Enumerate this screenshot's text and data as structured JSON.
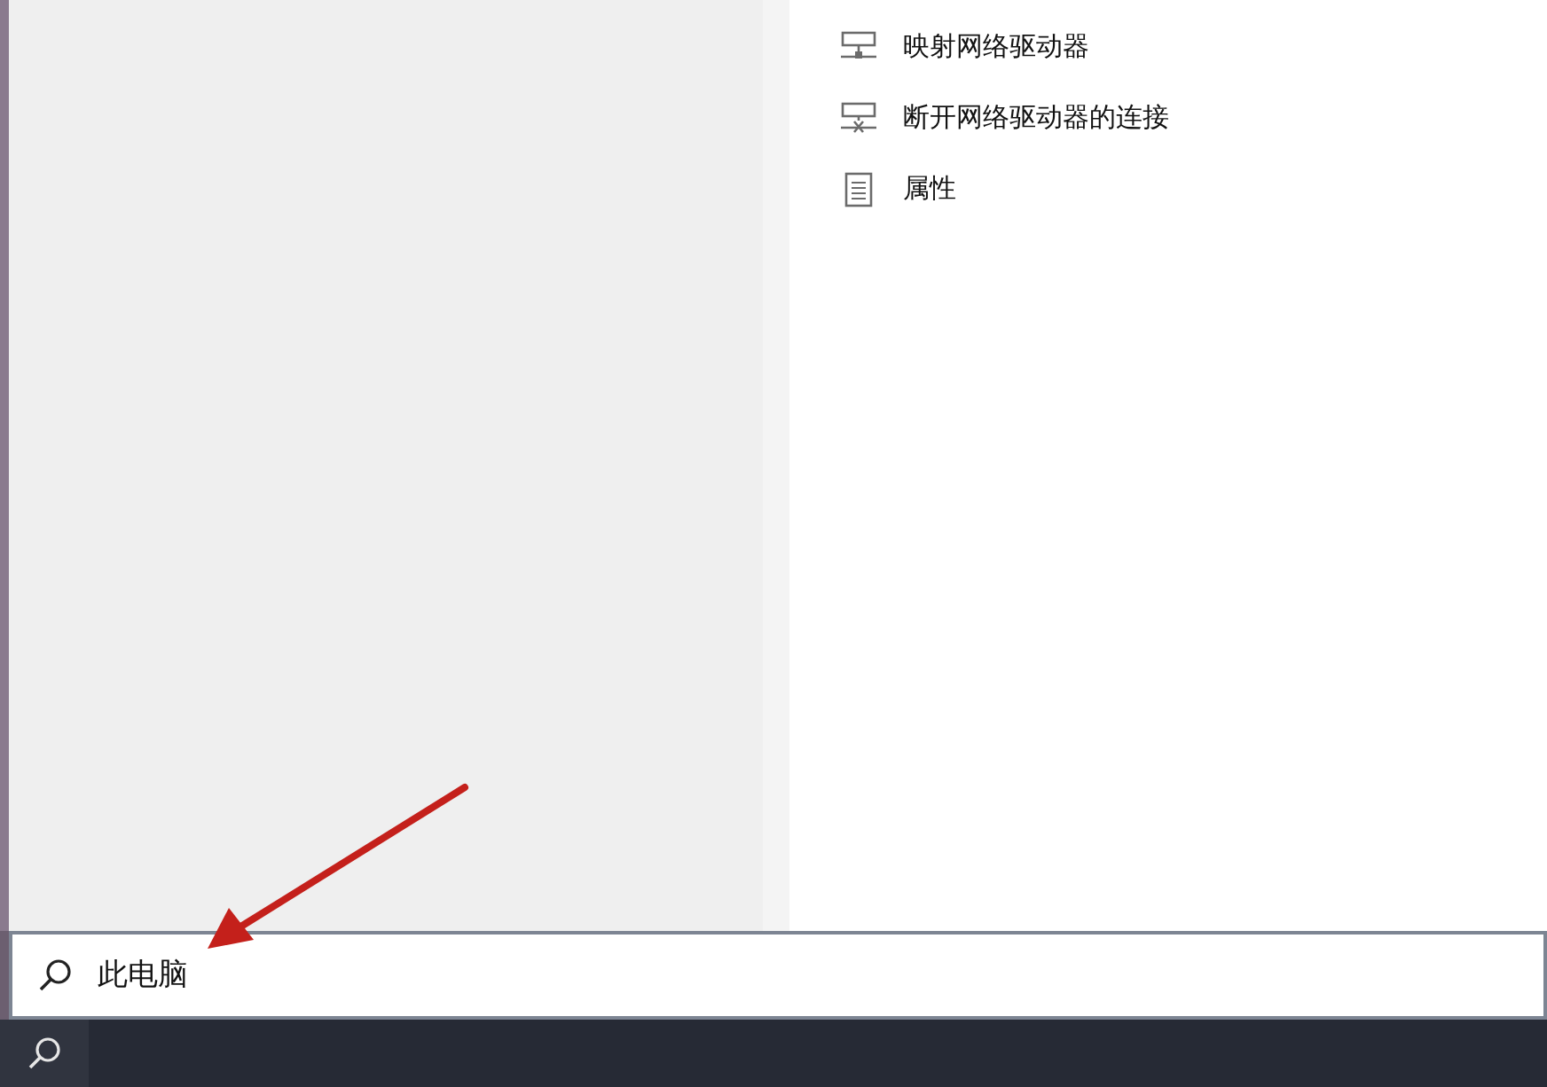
{
  "actions": [
    {
      "kind": "map-drive",
      "label": "映射网络驱动器"
    },
    {
      "kind": "disconnect-drive",
      "label": "断开网络驱动器的连接"
    },
    {
      "kind": "properties",
      "label": "属性"
    }
  ],
  "search": {
    "value": "此电脑"
  }
}
